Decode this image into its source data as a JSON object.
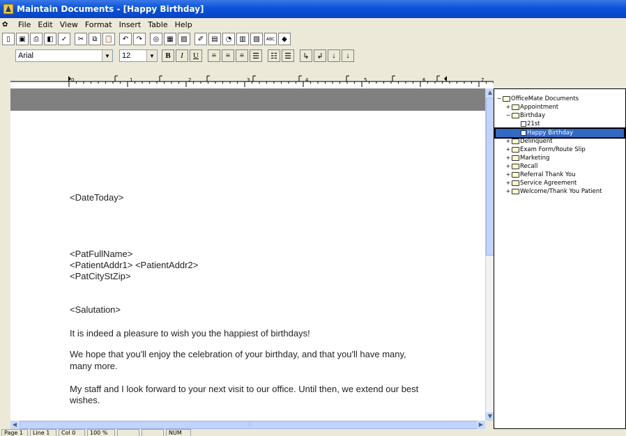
{
  "window": {
    "title": "Maintain Documents - [Happy Birthday]"
  },
  "menu": {
    "items": [
      "File",
      "Edit",
      "View",
      "Format",
      "Insert",
      "Table",
      "Help"
    ]
  },
  "toolbar": {
    "font": "Arial",
    "size": "12",
    "bold": "B",
    "italic": "I",
    "underline": "U"
  },
  "ruler": {
    "labels": [
      "0",
      "1",
      "2",
      "3",
      "4",
      "5",
      "6",
      "7"
    ]
  },
  "document": {
    "lines": [
      "<DateToday>",
      "<PatFullName>",
      "<PatientAddr1> <PatientAddr2>",
      "<PatCityStZip>",
      "<Salutation>",
      "It is indeed a pleasure to wish you the happiest of birthdays!",
      "We hope that you'll enjoy the celebration of your birthday, and that you'll have many,",
      "many more.",
      "My staff and I look forward to your next visit to our office. Until then, we extend our best",
      "wishes."
    ]
  },
  "tree": {
    "root": "OfficeMate Documents",
    "items": [
      {
        "label": "Appointment",
        "expander": "+",
        "type": "folder"
      },
      {
        "label": "Birthday",
        "expander": "−",
        "type": "folder-open"
      },
      {
        "label": "21st",
        "expander": "",
        "type": "doc"
      },
      {
        "label": "Happy Birthday",
        "expander": "",
        "type": "doc",
        "selected": true
      },
      {
        "label": "Delinquent",
        "expander": "+",
        "type": "folder"
      },
      {
        "label": "Exam Form/Route Slip",
        "expander": "+",
        "type": "folder"
      },
      {
        "label": "Marketing",
        "expander": "+",
        "type": "folder-open"
      },
      {
        "label": "Recall",
        "expander": "+",
        "type": "folder"
      },
      {
        "label": "Referral Thank You",
        "expander": "+",
        "type": "folder"
      },
      {
        "label": "Service Agreement",
        "expander": "+",
        "type": "folder"
      },
      {
        "label": "Welcome/Thank You Patient",
        "expander": "+",
        "type": "folder"
      }
    ]
  },
  "status": {
    "page": "Page 1",
    "line": "Line 1",
    "col": "Col 0",
    "zoom": "100 %",
    "num": "NUM"
  }
}
